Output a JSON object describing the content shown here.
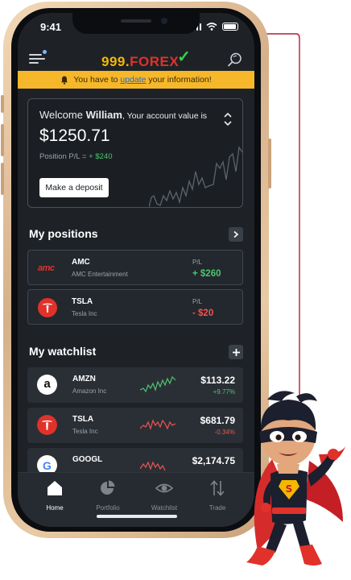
{
  "status_bar": {
    "time": "9:41"
  },
  "header": {
    "logo_number": "999.",
    "logo_brand": "FOREX",
    "logo_check": "✓"
  },
  "alert": {
    "prefix": "You have to ",
    "link": "update",
    "suffix": " your information!"
  },
  "account": {
    "welcome_prefix": "Welcome ",
    "name": "William",
    "welcome_suffix": ", Your account value is",
    "value": "$1250.71",
    "pl_label": "Position P/L = ",
    "pl_value": "+ $240",
    "deposit_label": "Make a deposit"
  },
  "positions": {
    "title": "My positions",
    "items": [
      {
        "ticker": "AMC",
        "name": "AMC Entertainment",
        "pl_label": "P/L",
        "pl_value": "+ $260",
        "logo_text": "amc"
      },
      {
        "ticker": "TSLA",
        "name": "Tesla Inc",
        "pl_label": "P/L",
        "pl_value": "- $20"
      }
    ]
  },
  "watchlist": {
    "title": "My watchlist",
    "items": [
      {
        "ticker": "AMZN",
        "name": "Amazon Inc",
        "price": "$113.22",
        "change": "+9.77%",
        "trend": "up",
        "logo_text": "a"
      },
      {
        "ticker": "TSLA",
        "name": "Tesla Inc",
        "price": "$681.79",
        "change": "-0.34%",
        "trend": "down"
      },
      {
        "ticker": "GOOGL",
        "name": "",
        "price": "$2,174.75",
        "change": "",
        "trend": "down",
        "logo_text": "G"
      }
    ]
  },
  "tabs": [
    {
      "label": "Home",
      "icon": "home-icon",
      "active": true
    },
    {
      "label": "Portfolio",
      "icon": "pie-chart-icon",
      "active": false
    },
    {
      "label": "Watchlist",
      "icon": "eye-icon",
      "active": false
    },
    {
      "label": "Trade",
      "icon": "up-down-arrows-icon",
      "active": false
    }
  ],
  "colors": {
    "accent_green": "#4ec46f",
    "accent_red": "#ef5350",
    "banner": "#f6b72a",
    "logo_red": "#e0322b",
    "logo_yellow": "#f5b800"
  }
}
